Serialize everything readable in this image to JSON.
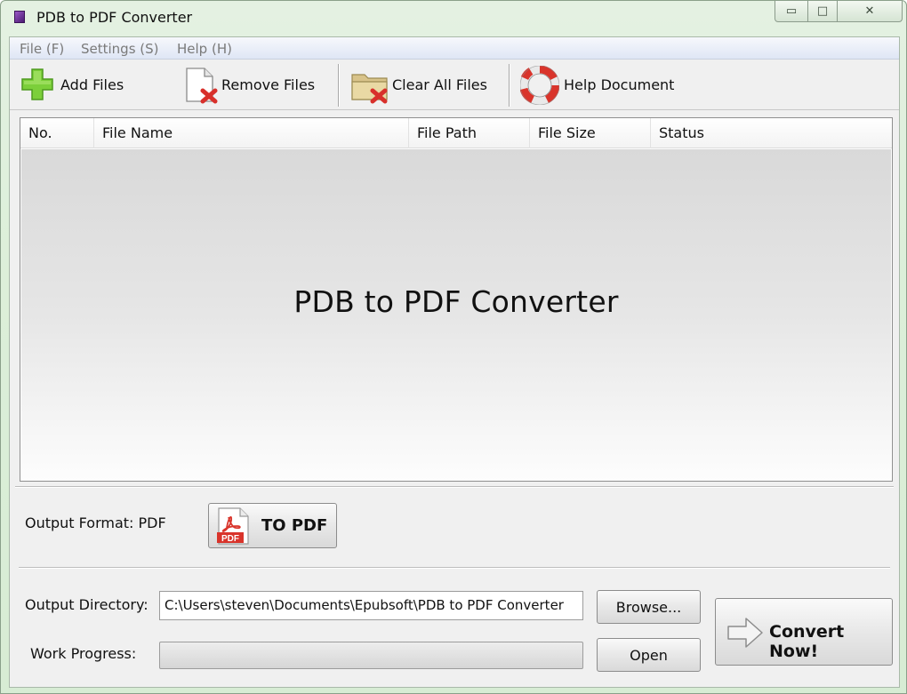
{
  "window": {
    "title": "PDB to PDF Converter",
    "controls": {
      "minimize": "▭",
      "maximize": "□",
      "close": "✕"
    }
  },
  "menu": {
    "items": [
      "File (F)",
      "Settings (S)",
      "Help (H)"
    ]
  },
  "toolbar": {
    "add_files": "Add Files",
    "remove_files": "Remove Files",
    "clear_all_files": "Clear All Files",
    "help_document": "Help Document"
  },
  "file_list": {
    "columns": [
      "No.",
      "File Name",
      "File Path",
      "File Size",
      "Status"
    ],
    "rows": [],
    "empty_text": "PDB to PDF Converter"
  },
  "output_format": {
    "label": "Output Format: PDF",
    "button_label": "TO PDF",
    "badge_text": "PDF"
  },
  "output_directory": {
    "label": "Output Directory:",
    "value": "C:\\Users\\steven\\Documents\\Epubsoft\\PDB to PDF Converter",
    "browse_label": "Browse..."
  },
  "work_progress": {
    "label": "Work Progress:",
    "progress": 0,
    "open_label": "Open"
  },
  "convert": {
    "label": "Convert Now!"
  },
  "colors": {
    "title_bg": "#dcefd9",
    "client_bg": "#f0f0f0",
    "menu_text": "#7a7a7a",
    "pdf_red": "#d9342b"
  },
  "icons": {
    "app": "pdb-app-icon",
    "add": "green-plus-icon",
    "remove": "document-red-x-icon",
    "clear": "folder-red-x-icon",
    "help": "lifebuoy-icon",
    "pdf": "adobe-pdf-icon",
    "convert": "right-arrow-icon"
  }
}
